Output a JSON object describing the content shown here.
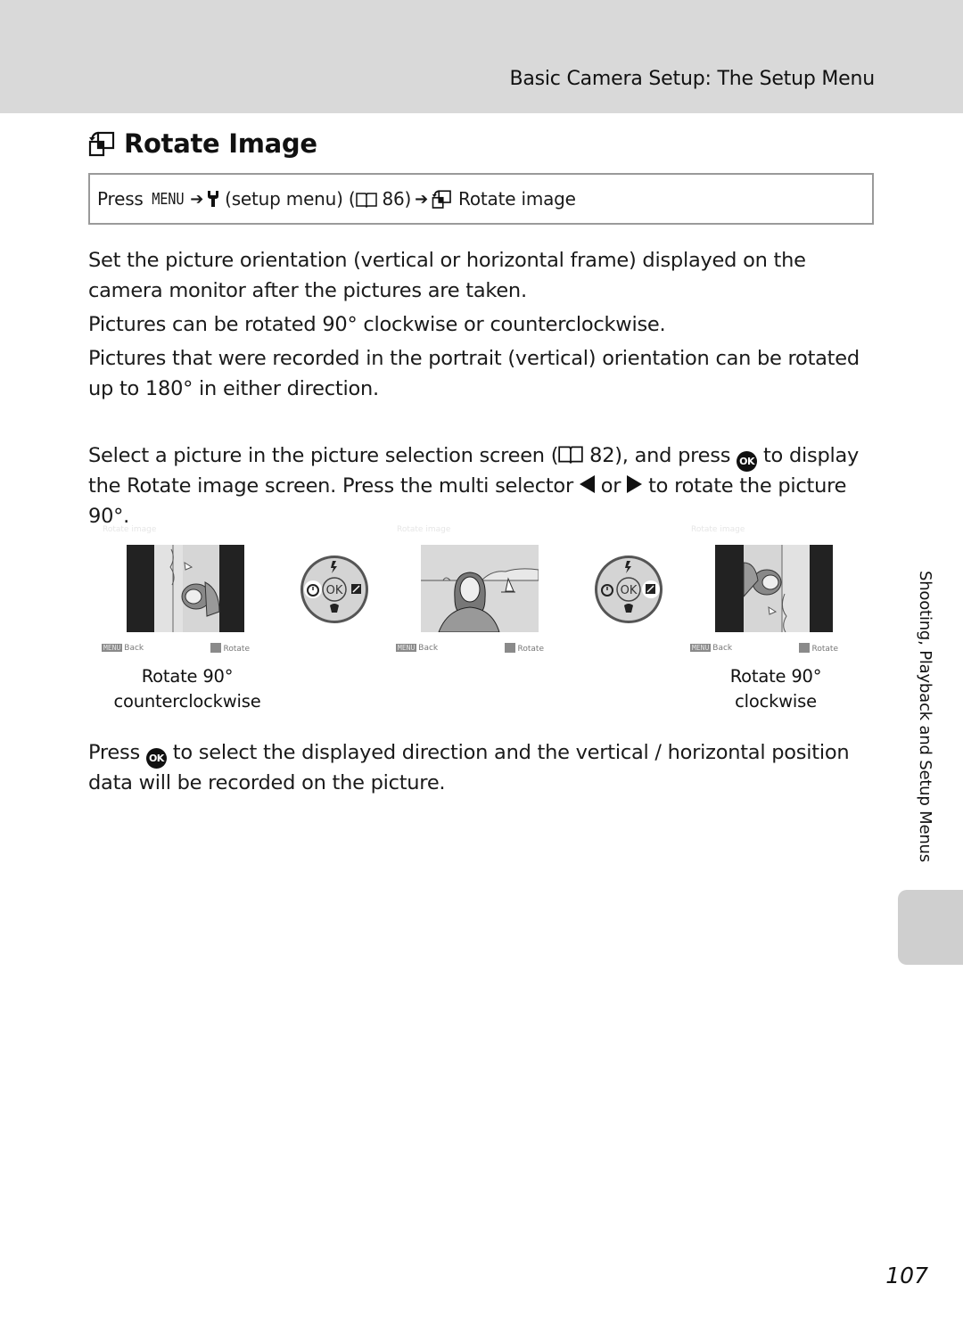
{
  "header": {
    "section_title": "Basic Camera Setup: The Setup Menu"
  },
  "page_title": {
    "icon": "rotate-image-icon",
    "text": "Rotate Image"
  },
  "nav_path": {
    "press": "Press",
    "menu_button": "MENU",
    "setup_icon": "wrench-icon",
    "setup_text": "(setup menu) (",
    "page_ref": "86)",
    "item_icon": "rotate-image-icon",
    "item_text": "Rotate image",
    "arrow": "➔"
  },
  "paragraphs": {
    "p1": "Set the picture orientation (vertical or horizontal frame) displayed on the camera monitor after the pictures are taken.",
    "p2": "Pictures can be rotated 90° clockwise or counterclockwise.",
    "p3": "Pictures that were recorded in the portrait (vertical) orientation can be rotated up to 180° in either direction.",
    "p4_a": "Select a picture in the picture selection screen (",
    "p4_ref": "82), and press",
    "p4_b": "to display the Rotate image screen. Press the multi selector",
    "p4_or": "or",
    "p4_c": "to rotate the picture 90°.",
    "p5_a": "Press",
    "p5_b": "to select the displayed direction and the vertical / horizontal position data will be recorded on the picture."
  },
  "ok_label": "OK",
  "screens": [
    {
      "title": "Rotate image",
      "back_label": "Back",
      "rotate_label": "Rotate",
      "menu_badge": "MENU",
      "orientation": "counterclockwise"
    },
    {
      "title": "Rotate image",
      "back_label": "Back",
      "rotate_label": "Rotate",
      "menu_badge": "MENU",
      "orientation": "original"
    },
    {
      "title": "Rotate image",
      "back_label": "Back",
      "rotate_label": "Rotate",
      "menu_badge": "MENU",
      "orientation": "clockwise"
    }
  ],
  "dials": [
    {
      "center": "OK",
      "highlight": "left"
    },
    {
      "center": "OK",
      "highlight": "right"
    }
  ],
  "captions": {
    "left_line1": "Rotate 90°",
    "left_line2": "counterclockwise",
    "right_line1": "Rotate 90°",
    "right_line2": "clockwise"
  },
  "side_tab": {
    "label": "Shooting, Playback and Setup Menus"
  },
  "page_number": "107"
}
